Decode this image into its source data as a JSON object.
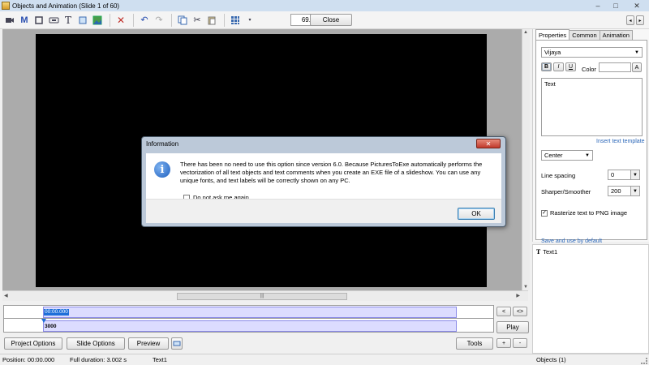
{
  "window": {
    "title": "Objects and Animation  (Slide 1 of 60)",
    "minimize": "–",
    "maximize": "□",
    "close": "✕"
  },
  "toolbar": {
    "zoom_value": "69.28%",
    "close_label": "Close",
    "prev_label": "◂",
    "next_label": "▸"
  },
  "dialog": {
    "title": "Information",
    "close_glyph": "✕",
    "message": "There has been no need to use this option since version 6.0. Because PicturesToExe automatically performs the vectorization of all text objects and text comments when you create an EXE file of a slideshow. You can use any unique fonts, and text labels will be correctly shown on any PC.",
    "checkbox_label": "Do not ask me again",
    "ok_label": "OK"
  },
  "properties": {
    "tabs": [
      "Properties",
      "Common",
      "Animation"
    ],
    "font_name": "Vijaya",
    "bold": "B",
    "italic": "I",
    "underline": "U",
    "color_label": "Color",
    "color_picker": "A",
    "text_value": "Text",
    "insert_template_link": "Insert text template",
    "align_value": "Center",
    "line_spacing_label": "Line spacing",
    "line_spacing_value": "0",
    "sharper_label": "Sharper/Smoother",
    "sharper_value": "200",
    "rasterize_label": "Rasterize text to PNG image",
    "rasterize_checked": true,
    "save_default_link": "Save and use by default"
  },
  "objects_list": [
    {
      "icon": "text-icon",
      "label": "Text1"
    }
  ],
  "timeline": {
    "position": "00:00.000",
    "duration": "3000",
    "prev": "<",
    "step": "<>",
    "play_label": "Play"
  },
  "bottom_buttons": {
    "project_options": "Project Options",
    "slide_options": "Slide Options",
    "preview": "Preview",
    "tools": "Tools",
    "plus": "+",
    "minus": "-"
  },
  "status": {
    "position": "Position:  00:00.000",
    "full_duration": "Full duration:  3.002 s",
    "selected": "Text1",
    "objects_count": "Objects (1)"
  },
  "colors": {
    "titlebar": "#cfdff0",
    "stage": "#000000",
    "link": "#2a66b8",
    "timeline_selection": "#1e6fd9",
    "dialog_close": "#c0392b"
  }
}
